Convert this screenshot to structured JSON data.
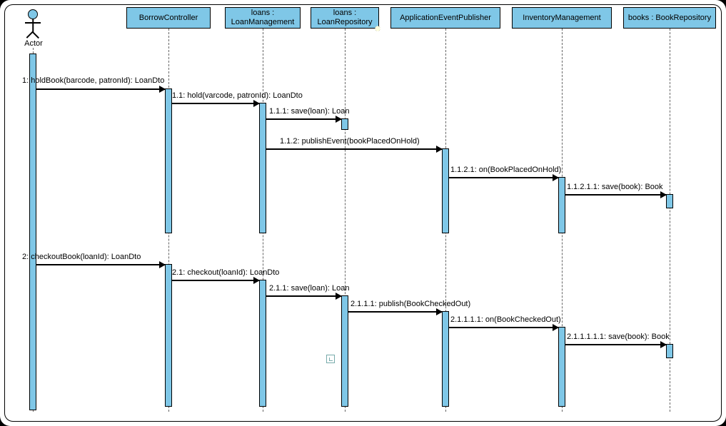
{
  "diagram": {
    "type": "UML Sequence Diagram"
  },
  "actor": {
    "label": "Actor"
  },
  "participants": [
    {
      "id": "borrow",
      "label": "BorrowController"
    },
    {
      "id": "loansMgmt",
      "label": "loans :\nLoanManagement"
    },
    {
      "id": "loansRepo",
      "label": "loans :\nLoanRepository"
    },
    {
      "id": "publisher",
      "label": "ApplicationEventPublisher"
    },
    {
      "id": "invMgmt",
      "label": "InventoryManagement"
    },
    {
      "id": "booksRepo",
      "label": "books : BookRepository"
    }
  ],
  "messages": [
    {
      "id": "m1",
      "text": "1: holdBook(barcode, patronId): LoanDto"
    },
    {
      "id": "m1_1",
      "text": "1.1: hold(varcode, patronId): LoanDto"
    },
    {
      "id": "m1_1_1",
      "text": "1.1.1: save(loan): Loan"
    },
    {
      "id": "m1_1_2",
      "text": "1.1.2: publishEvent(bookPlacedOnHold)"
    },
    {
      "id": "m1_1_2_1",
      "text": "1.1.2.1: on(BookPlacedOnHold)"
    },
    {
      "id": "m1_1_2_1_1",
      "text": "1.1.2.1.1: save(book): Book"
    },
    {
      "id": "m2",
      "text": "2: checkoutBook(loanId): LoanDto"
    },
    {
      "id": "m2_1",
      "text": "2.1: checkout(loanId): LoanDto"
    },
    {
      "id": "m2_1_1",
      "text": "2.1.1: save(loan): Loan"
    },
    {
      "id": "m2_1_1_1",
      "text": "2.1.1.1: publish(BookCheckedOut)"
    },
    {
      "id": "m2_1_1_1_1",
      "text": "2.1.1.1.1: on(BookCheckedOut)"
    },
    {
      "id": "m2_1_1_1_1_1",
      "text": "2.1.1.1.1.1: save(book): Book"
    }
  ],
  "chart_data": {
    "type": "sequence-diagram",
    "participants": [
      "Actor",
      "BorrowController",
      "loans : LoanManagement",
      "loans : LoanRepository",
      "ApplicationEventPublisher",
      "InventoryManagement",
      "books : BookRepository"
    ],
    "sequences": [
      {
        "name": "holdBook",
        "calls": [
          {
            "from": "Actor",
            "to": "BorrowController",
            "label": "1: holdBook(barcode, patronId): LoanDto"
          },
          {
            "from": "BorrowController",
            "to": "loans : LoanManagement",
            "label": "1.1: hold(varcode, patronId): LoanDto"
          },
          {
            "from": "loans : LoanManagement",
            "to": "loans : LoanRepository",
            "label": "1.1.1: save(loan): Loan"
          },
          {
            "from": "loans : LoanManagement",
            "to": "ApplicationEventPublisher",
            "label": "1.1.2: publishEvent(bookPlacedOnHold)"
          },
          {
            "from": "ApplicationEventPublisher",
            "to": "InventoryManagement",
            "label": "1.1.2.1: on(BookPlacedOnHold)"
          },
          {
            "from": "InventoryManagement",
            "to": "books : BookRepository",
            "label": "1.1.2.1.1: save(book): Book"
          }
        ]
      },
      {
        "name": "checkoutBook",
        "calls": [
          {
            "from": "Actor",
            "to": "BorrowController",
            "label": "2: checkoutBook(loanId): LoanDto"
          },
          {
            "from": "BorrowController",
            "to": "loans : LoanManagement",
            "label": "2.1: checkout(loanId): LoanDto"
          },
          {
            "from": "loans : LoanManagement",
            "to": "loans : LoanRepository",
            "label": "2.1.1: save(loan): Loan"
          },
          {
            "from": "loans : LoanRepository",
            "to": "ApplicationEventPublisher",
            "label": "2.1.1.1: publish(BookCheckedOut)"
          },
          {
            "from": "ApplicationEventPublisher",
            "to": "InventoryManagement",
            "label": "2.1.1.1.1: on(BookCheckedOut)"
          },
          {
            "from": "InventoryManagement",
            "to": "books : BookRepository",
            "label": "2.1.1.1.1.1: save(book): Book"
          }
        ]
      }
    ]
  }
}
